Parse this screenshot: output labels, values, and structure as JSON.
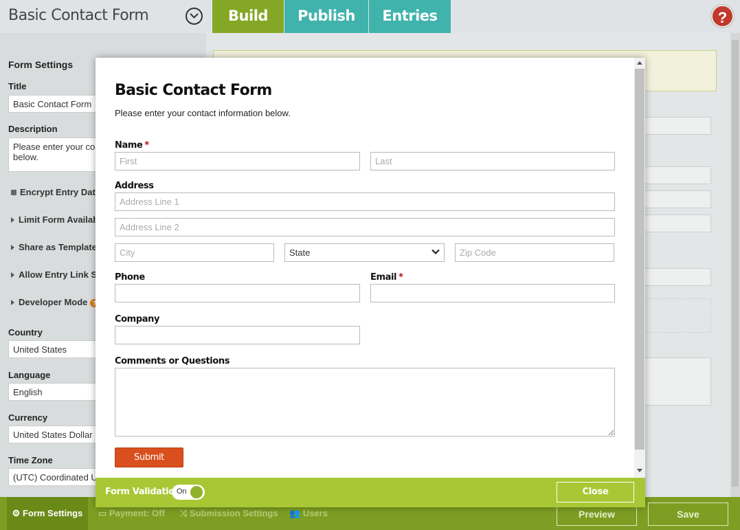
{
  "app": {
    "title": "Basic Contact Form",
    "tabs": [
      {
        "label": "Build",
        "color": "#84a826"
      },
      {
        "label": "Publish",
        "color": "#3fb3ac"
      },
      {
        "label": "Entries",
        "color": "#3fb3ac"
      }
    ],
    "help_symbol": "?"
  },
  "settings": {
    "heading": "Form Settings",
    "title_label": "Title",
    "title_value": "Basic Contact Form",
    "description_label": "Description",
    "description_value": "Please enter your co... below.",
    "description_line1": "Please enter your co",
    "description_line2": "below.",
    "toggles": [
      "Encrypt Entry Data?",
      "Limit Form Availabi",
      "Share as Template?",
      "Allow Entry Link Sha",
      "Developer Mode"
    ],
    "country_label": "Country",
    "country_value": "United States",
    "language_label": "Language",
    "language_value": "English",
    "currency_label": "Currency",
    "currency_value": "United States Dollar",
    "timezone_label": "Time Zone",
    "timezone_value": "(UTC) Coordinated U"
  },
  "bottombar": {
    "tabs": [
      "Form Settings",
      "Payment: Off",
      "Submission Settings",
      "Users"
    ],
    "preview_label": "Preview",
    "save_label": "Save"
  },
  "modal": {
    "form_title": "Basic Contact Form",
    "form_description": "Please enter your contact information below.",
    "name_label": "Name",
    "required_mark": "*",
    "first_placeholder": "First",
    "last_placeholder": "Last",
    "address_label": "Address",
    "address1_placeholder": "Address Line 1",
    "address2_placeholder": "Address Line 2",
    "city_placeholder": "City",
    "state_value": "State",
    "zip_placeholder": "Zip Code",
    "phone_label": "Phone",
    "email_label": "Email",
    "company_label": "Company",
    "comments_label": "Comments or Questions",
    "submit_label": "Submit",
    "form_validation_label": "Form Validation",
    "toggle_state": "On",
    "close_label": "Close"
  }
}
